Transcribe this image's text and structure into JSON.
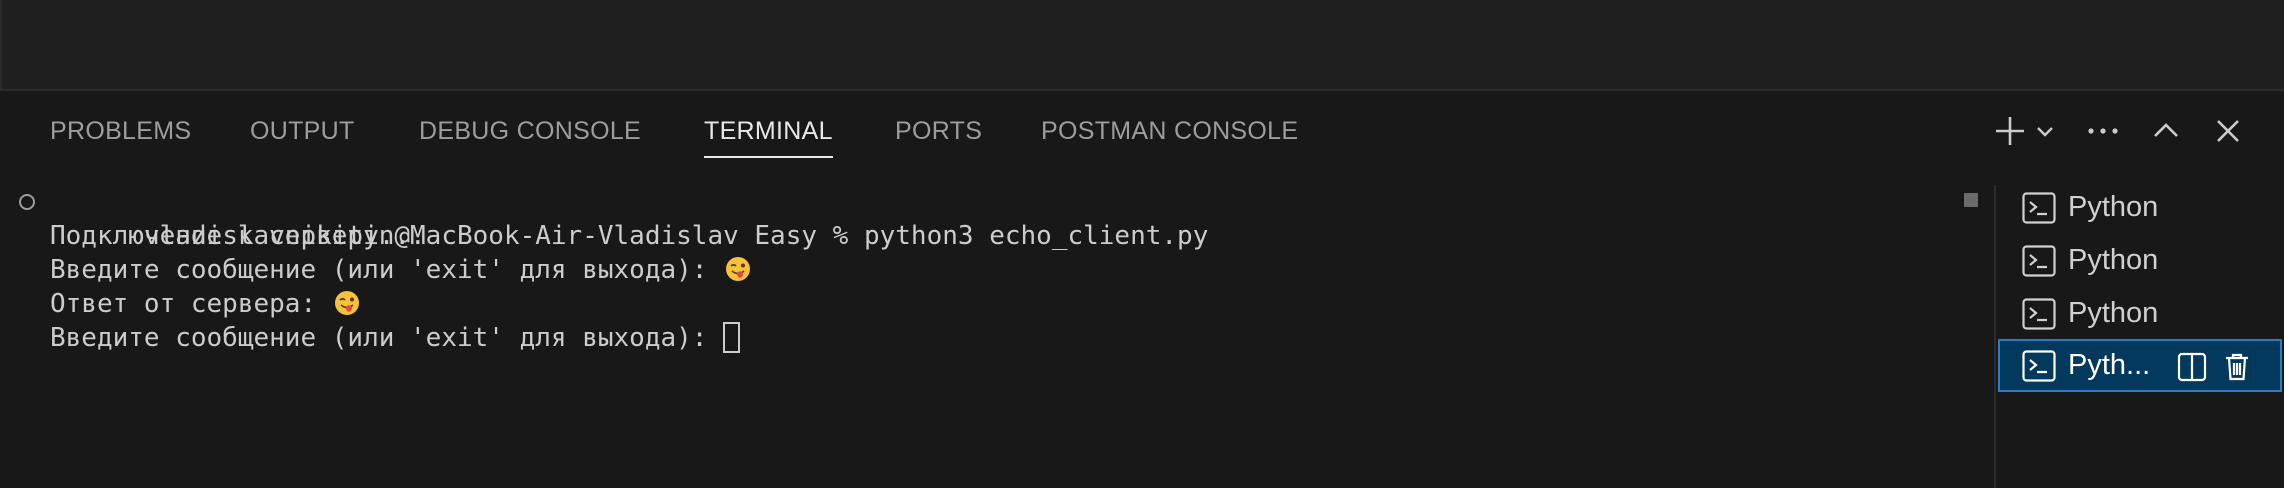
{
  "panel": {
    "tabs": [
      {
        "label": "PROBLEMS"
      },
      {
        "label": "OUTPUT"
      },
      {
        "label": "DEBUG CONSOLE"
      },
      {
        "label": "TERMINAL",
        "active": true
      },
      {
        "label": "PORTS"
      },
      {
        "label": "POSTMAN CONSOLE"
      }
    ],
    "actions": [
      "plus-icon",
      "chevron-down-icon",
      "more-icon",
      "chevron-up-icon",
      "close-icon"
    ]
  },
  "terminal": {
    "lines": [
      "vladislavnikitin@MacBook-Air-Vladislav Easy % python3 echo_client.py",
      "Подключение к серверу...",
      "Введите сообщение (или 'exit' для выхода): ",
      "Ответ от сервера: ",
      "Введите сообщение (или 'exit' для выхода): "
    ],
    "emoji": "winking-face-with-tongue-icon"
  },
  "terminal_list": {
    "items": [
      {
        "label": "Python"
      },
      {
        "label": "Python"
      },
      {
        "label": "Python"
      },
      {
        "label": "Pyth...",
        "selected": true
      }
    ]
  },
  "colors": {
    "panel_bg": "#181818",
    "active_tab": "#e7e7e7",
    "inactive_tab": "#9d9d9d",
    "selection_bg": "#04395e",
    "selection_border": "#2d7bc4"
  }
}
